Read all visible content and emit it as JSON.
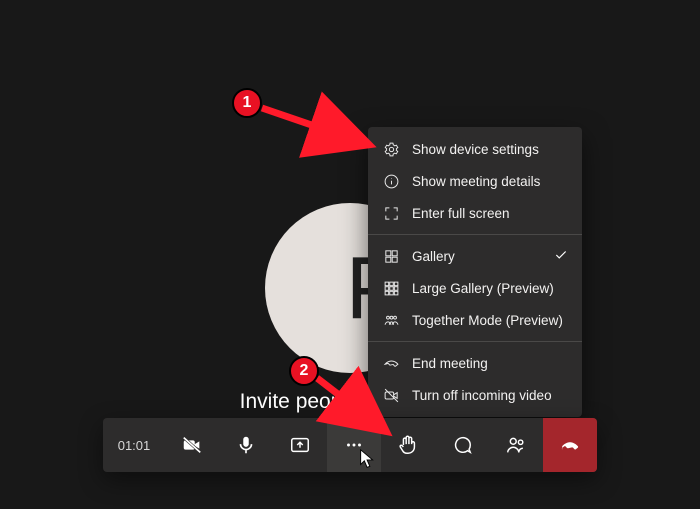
{
  "avatar_initial": "P",
  "invite_text": "Invite people to join you",
  "timer": "01:01",
  "menu": {
    "device_settings": "Show device settings",
    "meeting_details": "Show meeting details",
    "fullscreen": "Enter full screen",
    "gallery": "Gallery",
    "large_gallery": "Large Gallery (Preview)",
    "together": "Together Mode (Preview)",
    "end_meeting": "End meeting",
    "turn_off_video": "Turn off incoming video"
  },
  "annotations": {
    "badge1": "1",
    "badge2": "2"
  }
}
